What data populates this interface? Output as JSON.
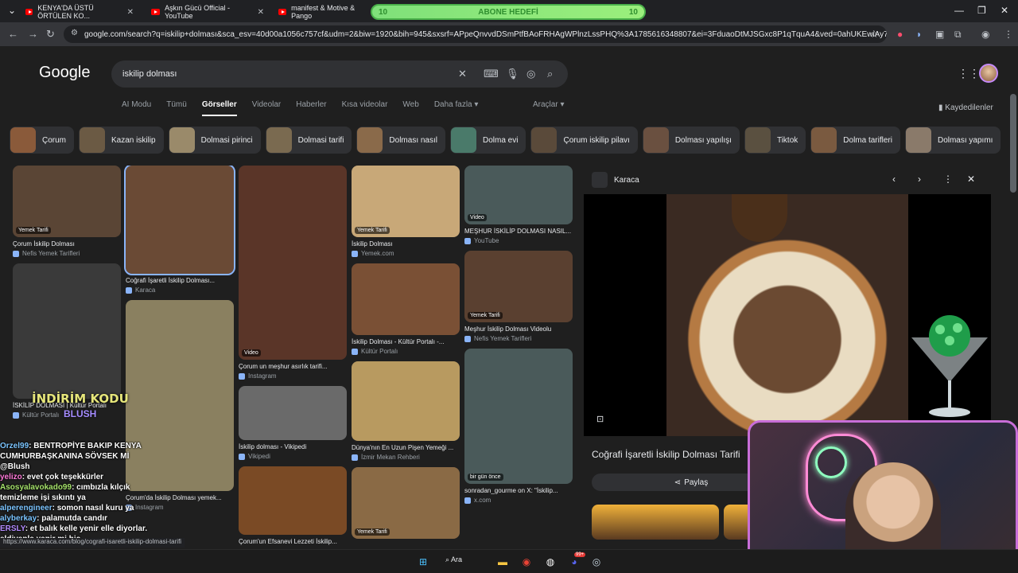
{
  "browser": {
    "tabs": [
      {
        "title": "KENYA'DA ÜSTÜ ÖRTÜLEN KO..."
      },
      {
        "title": "Aşkın Gücü Official - YouTube"
      },
      {
        "title": "manifest & Motive & Pango"
      }
    ],
    "overlay": {
      "left_num": "10",
      "label": "ABONE HEDEFİ",
      "right_num": "10"
    },
    "url": "google.com/search?q=iskilip+dolması&sca_esv=40d00a1056c757cf&udm=2&biw=1920&bih=945&sxsrf=APpeQnvvdDSmPtfBAoFRHAgWPlnzLssPHQ%3A1785616348807&ei=3FduaoDtMJSGxc8P1qTquA4&ved=0ahUKEwiAy7Oho4CWAx..."
  },
  "search": {
    "logo": "Google",
    "query": "iskilip dolması",
    "tabs": [
      "AI Modu",
      "Tümü",
      "Görseller",
      "Videolar",
      "Haberler",
      "Kısa videolar",
      "Web",
      "Daha fazla ▾"
    ],
    "active_tab": "Görseller",
    "tools": "Araçlar ▾",
    "saved": "Kaydedilenler"
  },
  "chips": [
    {
      "label": "Çorum",
      "color": "#8a5a3a"
    },
    {
      "label": "Kazan iskilip",
      "color": "#6b5a44"
    },
    {
      "label": "Dolmasi pirinci",
      "color": "#9a8a6a"
    },
    {
      "label": "Dolmasi tarifi",
      "color": "#7a6a50"
    },
    {
      "label": "Dolması nasıl",
      "color": "#8a6a4a"
    },
    {
      "label": "Dolma evi",
      "color": "#4a7a6a"
    },
    {
      "label": "Çorum iskilip pilavı",
      "color": "#5a4a3a"
    },
    {
      "label": "Dolması yapılışı",
      "color": "#6a5040"
    },
    {
      "label": "Tiktok",
      "color": "#5a5040"
    },
    {
      "label": "Dolma tarifleri",
      "color": "#7a5a40"
    },
    {
      "label": "Dolması yapımı",
      "color": "#8a7a6a"
    }
  ],
  "results": {
    "col1": [
      {
        "title": "Çorum İskilip Dolması",
        "source": "Nefis Yemek Tarifleri",
        "tag": "Yemek Tarifi",
        "color": "#5a4535"
      },
      {
        "title": "İSKİLİP DOLMASI | Kültür Portalı",
        "source": "Kültür Portalı",
        "tag": "",
        "color": "#3a3a3a"
      }
    ],
    "col2": [
      {
        "title": "Coğrafi İşaretli İskilip Dolması...",
        "source": "Karaca",
        "tag": "",
        "color": "#6a4a35"
      },
      {
        "title": "Çorum'da İskilip Dolması yemek...",
        "source": "Instagram",
        "tag": "",
        "color": "#8a8060"
      }
    ],
    "col3": [
      {
        "title": "Çorum un meşhur asırlık tarifi...",
        "source": "Instagram",
        "tag": "Video",
        "color": "#5a3528"
      },
      {
        "title": "İskilip dolması - Vikipedi",
        "source": "Vikipedi",
        "tag": "",
        "color": "#6a6a6a"
      },
      {
        "title": "Çorum'un Efsanevi Lezzeti İskilip...",
        "source": "",
        "tag": "",
        "color": "#7a4a25"
      }
    ],
    "col4": [
      {
        "title": "İskilip Dolması",
        "source": "Yemek.com",
        "tag": "Yemek Tarifi",
        "color": "#c8a878"
      },
      {
        "title": "İskilip Dolması - Kültür Portalı -...",
        "source": "Kültür Portalı",
        "tag": "",
        "color": "#7a5035"
      },
      {
        "title": "Dünya'nın En Uzun Pişen Yemeği ...",
        "source": "İzmir Mekan Rehberi",
        "tag": "",
        "color": "#b89a60"
      },
      {
        "title": "",
        "source": "",
        "tag": "Yemek Tarifi",
        "color": "#8a6a45"
      }
    ],
    "col5": [
      {
        "title": "MEŞHUR İSKİLİP DOLMASI NASIL...",
        "source": "YouTube",
        "tag": "Video",
        "color": "#4a5a5a"
      },
      {
        "title": "Meşhur İskilip Dolması Videolu",
        "source": "Nefis Yemek Tarifleri",
        "tag": "Yemek Tarifi",
        "color": "#5a4030"
      },
      {
        "title": "sonradan_gourme on X: \"İskilip...",
        "source": "x.com",
        "tag": "bir gün önce",
        "color": "#4a5a5a"
      }
    ]
  },
  "panel": {
    "source": "Karaca",
    "title": "Coğrafi İşaretli İskilip Dolması Tarifi",
    "share": "Paylaş"
  },
  "overlay_chat": {
    "promo": "İNDİRİM KODU",
    "promo_code": "BLUSH",
    "messages": [
      {
        "user": "Orzel99",
        "text": ": BENTROPİYE BAKIP KENYA CUMHURBAŞKANINA SÖVSEK Mİ @Blush"
      },
      {
        "user": "yelizo",
        "text": ": evet çok teşekkürler"
      },
      {
        "user": "Asosyalavokado99",
        "text": ": cımbızla kılçık temizleme işi sıkıntı ya"
      },
      {
        "user": "alperengineer",
        "text": ": somon nasıl kuru ya"
      },
      {
        "user": "alyberkay",
        "text": ": palamutda candır"
      },
      {
        "user": "ERSLY",
        "text": ": et balık kelle yenir elle diyorlar. eldivenle yenir mi hiç"
      }
    ]
  },
  "status_url": "https://www.karaca.com/blog/cografi-isaretli-iskilip-dolmasi-tarifi",
  "taskbar": {
    "search": "Ara",
    "badge": "99+"
  }
}
